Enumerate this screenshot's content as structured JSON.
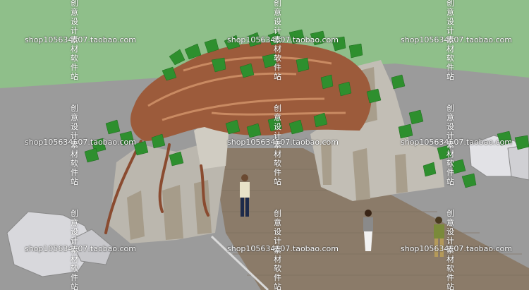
{
  "scene": {
    "sky_color": "#8fbf8a",
    "ground_color": "#9a9a9a",
    "path_color": "#8a7a68",
    "rock_color": "#bdb9b0",
    "wood_color": "#9a5a3a",
    "leaf_color": "#2a8a2a"
  },
  "watermarks": {
    "shop_text": "shop105634507.taobao.com",
    "vertical_text": "创意设计素材软件站"
  }
}
